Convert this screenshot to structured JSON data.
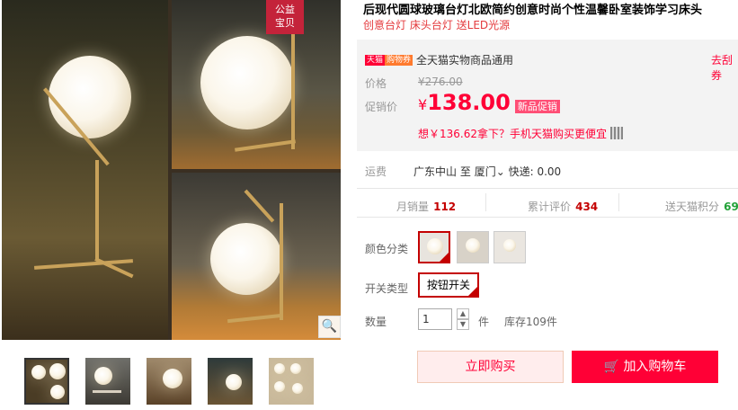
{
  "product": {
    "title": "后现代圆球玻璃台灯北欧简约创意时尚个性温馨卧室装饰学习床头",
    "subtitle": "创意台灯 床头台灯 送LED光源"
  },
  "image": {
    "badge_line1": "公益",
    "badge_line2": "宝贝",
    "zoom_icon": "🔍",
    "thumbnail_count": 5
  },
  "price_box": {
    "tmall_tag": "天猫",
    "giftcard_tag": "购物券",
    "giftcard_text": "全天猫实物商品通用",
    "giftcard_link": "去刮券",
    "original_label": "价格",
    "original_price": "¥276.00",
    "promo_label": "促销价",
    "promo_currency": "¥",
    "promo_price": "138.00",
    "promo_badge": "新品促销",
    "mobile_line": "想￥136.62拿下？手机天猫购买更便宜"
  },
  "delivery": {
    "label": "运费",
    "from": "广东中山",
    "to_word": "至",
    "to_city": "厦门",
    "express": "快递: 0.00"
  },
  "stats": {
    "monthly_label": "月销量",
    "monthly_value": "112",
    "reviews_label": "累计评价",
    "reviews_value": "434",
    "points_label": "送天猫积分",
    "points_value": "69"
  },
  "options": {
    "color_label": "颜色分类",
    "switch_label": "开关类型",
    "switch_value": "按钮开关"
  },
  "quantity": {
    "label": "数量",
    "value": "1",
    "unit": "件",
    "stock": "库存109件"
  },
  "actions": {
    "buy_now": "立即购买",
    "add_to_cart": "加入购物车"
  },
  "colors": {
    "accent": "#ff0036",
    "dark_red": "#c40000",
    "points_green": "#22a137"
  }
}
